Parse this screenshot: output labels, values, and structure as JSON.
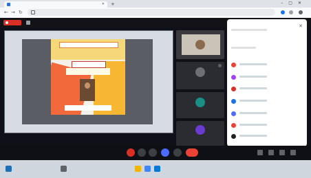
{
  "browser": {
    "tab_title": "",
    "url": ""
  },
  "meet": {
    "title": "",
    "time": "",
    "rec_color": "#d93025",
    "accent": "#4d6bfe"
  },
  "participants": [
    {
      "name": "",
      "avatar_color": "#8a6b4e"
    },
    {
      "name": "",
      "avatar_color": "#6d6f74"
    },
    {
      "name": "",
      "avatar_color": "#1a8f86"
    },
    {
      "name": "",
      "avatar_color": "#6a3bd1"
    }
  ],
  "chat_panel": {
    "icons": [
      "#ea4335",
      "#a142f4",
      "#d93025",
      "#1a73e8",
      "#4d6bfe",
      "#ea4335",
      "#d93025",
      "#202124"
    ]
  },
  "taskbar": {
    "clock": ""
  }
}
